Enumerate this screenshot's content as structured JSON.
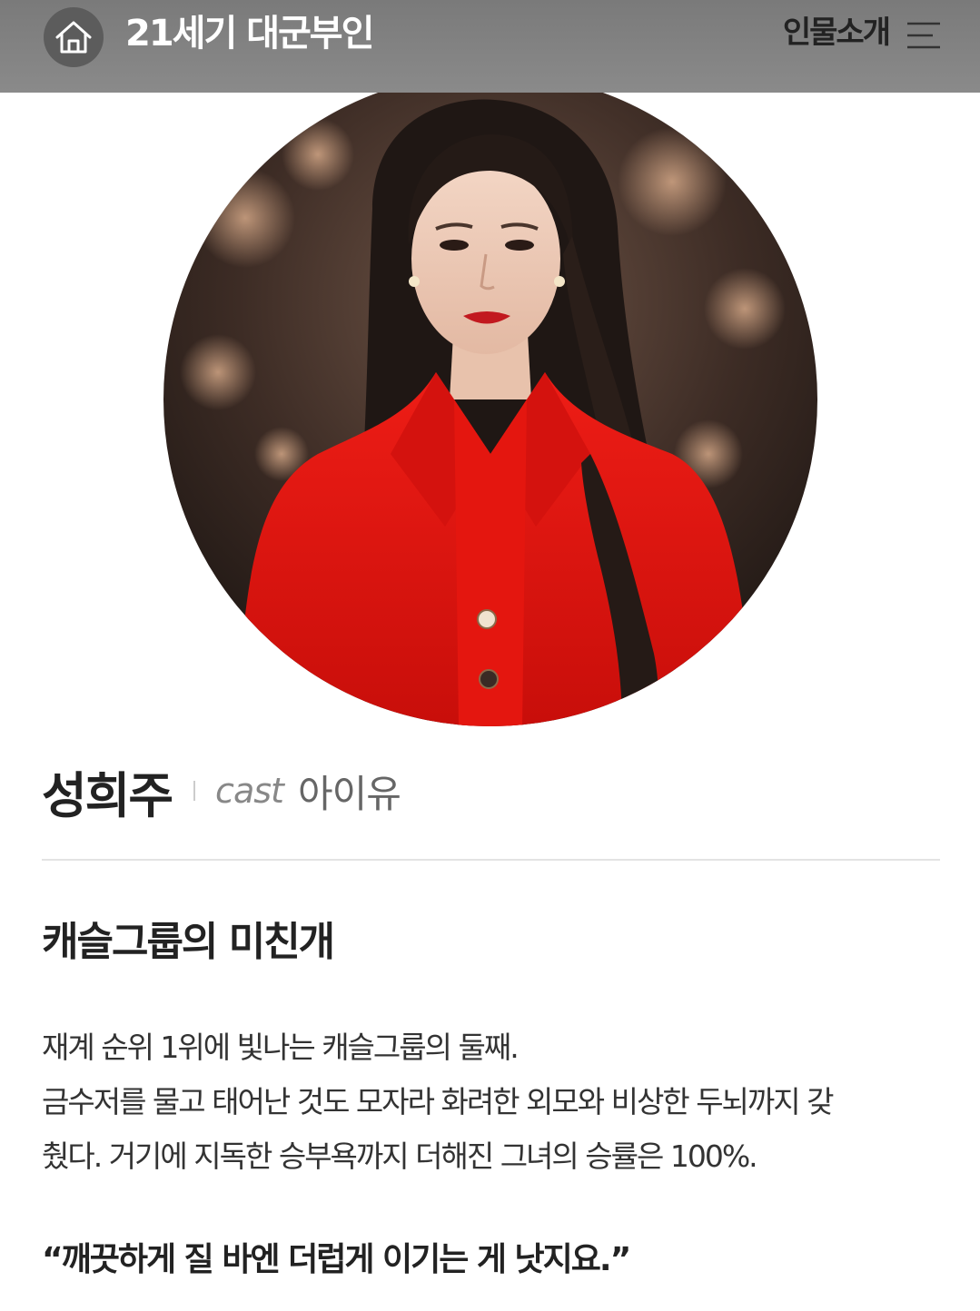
{
  "header": {
    "title": "21세기 대군부인",
    "section_label": "인물소개",
    "home_icon": "home-icon",
    "menu_icon": "hamburger-menu-icon"
  },
  "profile": {
    "photo_desc": "portrait-photo",
    "character_name": "성희주",
    "cast_label": "cast",
    "actor_name": "아이유"
  },
  "headline": "캐슬그룹의 미친개",
  "description": {
    "line1": "재계 순위 1위에 빛나는 캐슬그룹의 둘째.",
    "line2": "금수저를 물고 태어난 것도 모자라 화려한 외모와 비상한 두뇌까지 갖",
    "line3": "췄다. 거기에 지독한 승부욕까지 더해진 그녀의 승률은 100%."
  },
  "quote": "“깨끗하게 질 바엔 더럽게 이기는 게 낫지요.”",
  "colors": {
    "header_bg": "#808080",
    "home_bg": "#5c5c5c",
    "jacket_red": "#e0130f",
    "text_dark": "#222222"
  }
}
